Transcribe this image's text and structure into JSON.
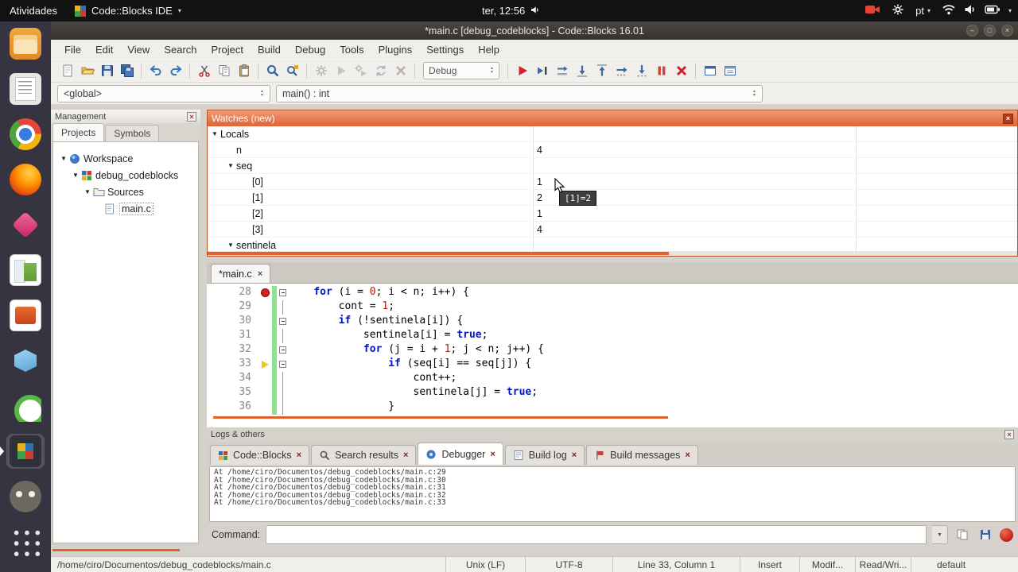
{
  "top_bar": {
    "activities": "Atividades",
    "app_name": "Code::Blocks IDE",
    "clock": "ter, 12:56",
    "keyboard_layout": "pt"
  },
  "titlebar": {
    "title": "*main.c [debug_codeblocks] - Code::Blocks 16.01"
  },
  "menu": {
    "items": [
      "File",
      "Edit",
      "View",
      "Search",
      "Project",
      "Build",
      "Debug",
      "Tools",
      "Plugins",
      "Settings",
      "Help"
    ]
  },
  "toolbar": {
    "groups": [
      {
        "buttons": [
          "new-file",
          "open-file",
          "save",
          "save-all"
        ]
      },
      {
        "buttons": [
          "undo",
          "redo"
        ]
      },
      {
        "buttons": [
          "cut",
          "copy",
          "paste"
        ]
      },
      {
        "buttons": [
          "find",
          "replace"
        ]
      },
      {
        "disabled": true,
        "buttons": [
          "build",
          "run",
          "build-and-run",
          "rebuild",
          "abort-build"
        ]
      },
      {
        "combo": "Debug"
      },
      {
        "buttons": [
          "debug-continue",
          "run-to-cursor",
          "next-line",
          "step-into",
          "step-out",
          "next-instruction",
          "step-into-instruction",
          "break-debugger",
          "stop-debugger"
        ]
      },
      {
        "buttons": [
          "debugging-windows",
          "various-info"
        ]
      }
    ]
  },
  "symbol_bar": {
    "scope": "<global>",
    "function": "main() : int"
  },
  "launcher": {
    "items": [
      {
        "name": "files"
      },
      {
        "name": "text-editor"
      },
      {
        "name": "chrome"
      },
      {
        "name": "firefox"
      },
      {
        "name": "remmina"
      },
      {
        "name": "libreoffice-calc"
      },
      {
        "name": "libreoffice-impress"
      },
      {
        "name": "boxes"
      },
      {
        "name": "green-app"
      },
      {
        "name": "codeblocks",
        "active": true
      },
      {
        "name": "gimp"
      },
      {
        "name": "app-grid"
      }
    ]
  },
  "management": {
    "title": "Management",
    "tabs": [
      {
        "label": "Projects"
      },
      {
        "label": "Symbols"
      }
    ],
    "tree": [
      {
        "label": "Workspace",
        "icon": "workspace-icon",
        "indent": 0,
        "expander": true
      },
      {
        "label": "debug_codeblocks",
        "icon": "project-icon",
        "indent": 1,
        "expander": true
      },
      {
        "label": "Sources",
        "icon": "folder-icon",
        "indent": 2,
        "expander": true
      },
      {
        "label": "main.c",
        "icon": "file-icon",
        "indent": 3,
        "expander": false,
        "selected": true
      }
    ]
  },
  "watches": {
    "title": "Watches (new)",
    "rows": [
      {
        "indent": 0,
        "expanded": true,
        "label": "Locals",
        "value": ""
      },
      {
        "indent": 1,
        "expanded": null,
        "label": "n",
        "value": "4"
      },
      {
        "indent": 1,
        "expanded": true,
        "label": "seq",
        "value": ""
      },
      {
        "indent": 2,
        "expanded": null,
        "label": "[0]",
        "value": "1"
      },
      {
        "indent": 2,
        "expanded": null,
        "label": "[1]",
        "value": "2"
      },
      {
        "indent": 2,
        "expanded": null,
        "label": "[2]",
        "value": "1"
      },
      {
        "indent": 2,
        "expanded": null,
        "label": "[3]",
        "value": "4"
      },
      {
        "indent": 1,
        "expanded": true,
        "label": "sentinela",
        "value": ""
      }
    ],
    "tooltip": "[1]=2"
  },
  "editor": {
    "tab": "*main.c",
    "lines": [
      {
        "num": "28",
        "marker": "breakpoint",
        "fold": "box",
        "segs": [
          [
            "p",
            "    "
          ],
          [
            "k",
            "for"
          ],
          [
            "p",
            " (i = "
          ],
          [
            "n",
            "0"
          ],
          [
            "p",
            "; i < n; i++) {"
          ]
        ]
      },
      {
        "num": "29",
        "marker": "",
        "fold": "line",
        "segs": [
          [
            "p",
            "        cont = "
          ],
          [
            "n",
            "1"
          ],
          [
            "p",
            ";"
          ]
        ]
      },
      {
        "num": "30",
        "marker": "",
        "fold": "box",
        "segs": [
          [
            "p",
            "        "
          ],
          [
            "k",
            "if"
          ],
          [
            "p",
            " (!sentinela[i]) {"
          ]
        ]
      },
      {
        "num": "31",
        "marker": "",
        "fold": "line",
        "segs": [
          [
            "p",
            "            sentinela[i] = "
          ],
          [
            "k",
            "true"
          ],
          [
            "p",
            ";"
          ]
        ]
      },
      {
        "num": "32",
        "marker": "",
        "fold": "box",
        "segs": [
          [
            "p",
            "            "
          ],
          [
            "k",
            "for"
          ],
          [
            "p",
            " (j = i + "
          ],
          [
            "n",
            "1"
          ],
          [
            "p",
            "; j < n; j++) {"
          ]
        ]
      },
      {
        "num": "33",
        "marker": "arrow",
        "fold": "box",
        "segs": [
          [
            "p",
            "                "
          ],
          [
            "k",
            "if"
          ],
          [
            "p",
            " (seq[i] == seq[j]) {"
          ]
        ]
      },
      {
        "num": "34",
        "marker": "",
        "fold": "line",
        "segs": [
          [
            "p",
            "                    cont++;"
          ]
        ]
      },
      {
        "num": "35",
        "marker": "",
        "fold": "line",
        "segs": [
          [
            "p",
            "                    sentinela[j] = "
          ],
          [
            "k",
            "true"
          ],
          [
            "p",
            ";"
          ]
        ]
      },
      {
        "num": "36",
        "marker": "",
        "fold": "line",
        "segs": [
          [
            "p",
            "                }"
          ]
        ]
      }
    ]
  },
  "logs": {
    "title": "Logs & others",
    "tabs": [
      {
        "label": "Code::Blocks",
        "icon": "codeblocks-log-icon",
        "active": false
      },
      {
        "label": "Search results",
        "icon": "search-results-icon",
        "active": false
      },
      {
        "label": "Debugger",
        "icon": "debugger-icon",
        "active": true
      },
      {
        "label": "Build log",
        "icon": "build-log-icon",
        "active": false
      },
      {
        "label": "Build messages",
        "icon": "build-messages-icon",
        "active": false
      }
    ],
    "debugger_output": [
      "At /home/ciro/Documentos/debug_codeblocks/main.c:29",
      "At /home/ciro/Documentos/debug_codeblocks/main.c:30",
      "At /home/ciro/Documentos/debug_codeblocks/main.c:31",
      "At /home/ciro/Documentos/debug_codeblocks/main.c:32",
      "At /home/ciro/Documentos/debug_codeblocks/main.c:33"
    ],
    "command_label": "Command:",
    "command_value": ""
  },
  "status_bar": {
    "file_path": "/home/ciro/Documentos/debug_codeblocks/main.c",
    "line_ending": "Unix (LF)",
    "encoding": "UTF-8",
    "caret": "Line 33, Column 1",
    "overtype": "Insert",
    "modified": "Modif...",
    "permissions": "Read/Wri...",
    "profile": "default"
  },
  "colors": {
    "accent_orange": "#e6602e",
    "watches_title": "#e06336",
    "keyword_blue": "#0018c0",
    "number_red": "#a81e12",
    "breakpoint_red": "#d21f1f",
    "current_line_yellow": "#efc715",
    "changed_line_green": "#8fe08f"
  }
}
